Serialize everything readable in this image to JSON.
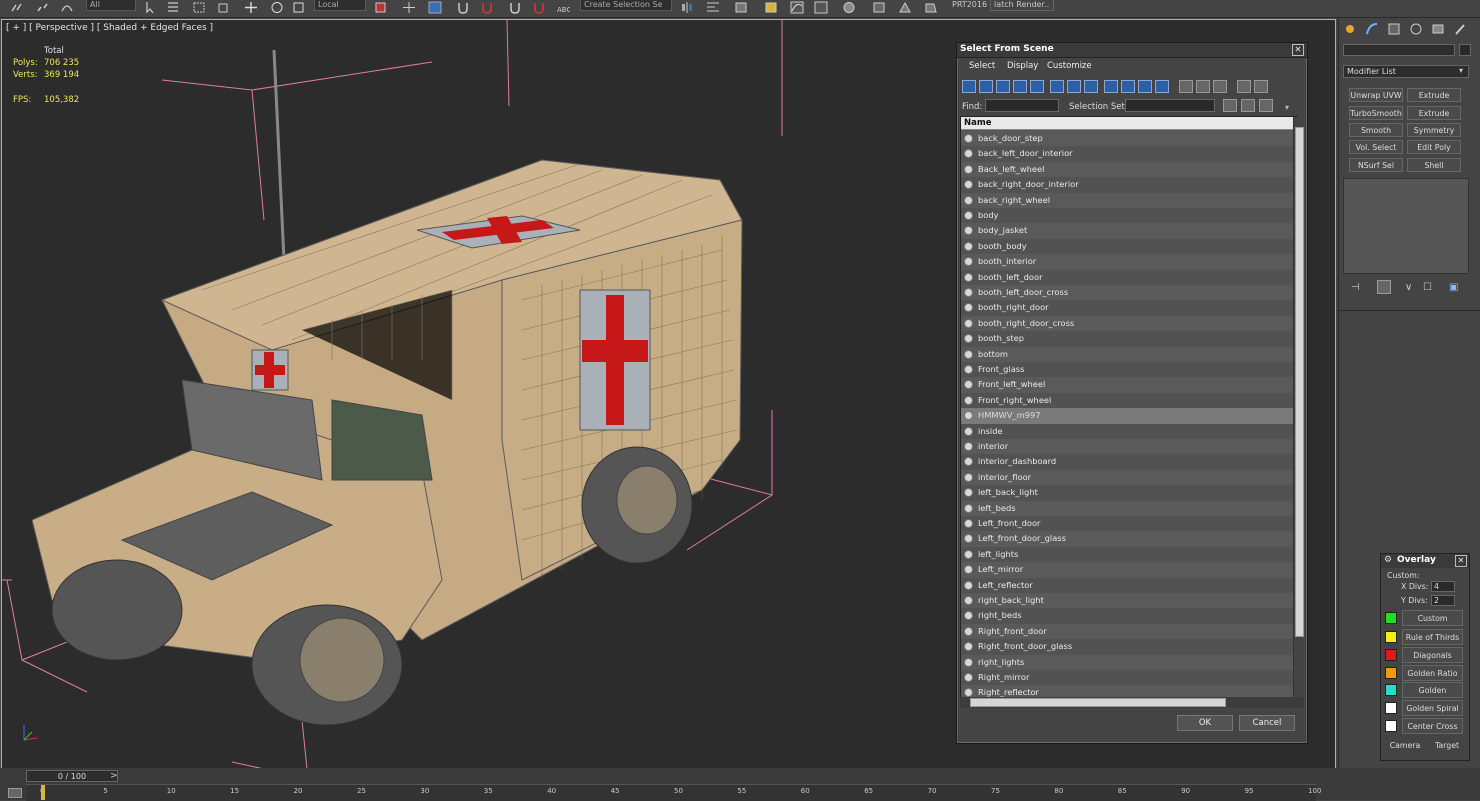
{
  "toolbar": {
    "coord_system": "Local",
    "named_selection": "Create Selection Se",
    "prt_label": "PRT2016",
    "batch_label": "latch Render..",
    "icons": [
      "link-icon",
      "unlink-icon",
      "bind-icon",
      "select-icon",
      "region-select-icon",
      "window-icon",
      "move-icon",
      "rotate-icon",
      "scale-icon",
      "pivot-icon",
      "snap-icon",
      "angle-snap-icon",
      "percent-snap-icon",
      "spinner-snap-icon",
      "edit-named-icon",
      "mirror-icon",
      "align-icon",
      "layer-icon",
      "scene-explorer-icon",
      "curve-editor-icon",
      "schematic-icon",
      "material-editor-icon",
      "render-setup-icon",
      "render-frame-icon",
      "render-icon"
    ]
  },
  "viewport": {
    "label": "[ + ] [ Perspective ] [ Shaded + Edged Faces ]",
    "stats": {
      "total_label": "Total",
      "polys_label": "Polys:",
      "polys_value": "706 235",
      "verts_label": "Verts:",
      "verts_value": "369 194",
      "fps_label": "FPS:",
      "fps_value": "105,382"
    },
    "colors": {
      "border": "#d4b545",
      "background": "#2c2c2c",
      "bbox": "#e07aa8"
    }
  },
  "dialog": {
    "title": "Select From Scene",
    "menu": [
      "Select",
      "Display",
      "Customize"
    ],
    "find_label": "Find:",
    "find_value": "",
    "selection_set_label": "Selection Set:",
    "list_header": "Name",
    "items": [
      "back_door_step",
      "back_left_door_interior",
      "Back_left_wheel",
      "back_right_door_interior",
      "back_right_wheel",
      "body",
      "body_jasket",
      "booth_body",
      "booth_interior",
      "booth_left_door",
      "booth_left_door_cross",
      "booth_right_door",
      "booth_right_door_cross",
      "booth_step",
      "bottom",
      "Front_glass",
      "Front_left_wheel",
      "Front_right_wheel",
      "HMMWV_m997",
      "inside",
      "interior",
      "interior_dashboard",
      "interior_floor",
      "left_back_light",
      "left_beds",
      "Left_front_door",
      "Left_front_door_glass",
      "left_lights",
      "Left_mirror",
      "Left_reflector",
      "right_back_light",
      "right_beds",
      "Right_front_door",
      "Right_front_door_glass",
      "right_lights",
      "Right_mirror",
      "Right_reflector"
    ],
    "selected_item": "HMMWV_m997",
    "ok_label": "OK",
    "cancel_label": "Cancel"
  },
  "right_panel": {
    "modifier_list": "Modifier List",
    "modifiers": [
      [
        "Unwrap UVW",
        "Extrude"
      ],
      [
        "TurboSmooth",
        "Extrude"
      ],
      [
        "Smooth",
        "Symmetry"
      ],
      [
        "Vol. Select",
        "Edit Poly"
      ],
      [
        "NSurf Sel",
        "Shell"
      ]
    ]
  },
  "overlay": {
    "title": "Overlay",
    "custom_label": "Custom:",
    "xdivs_label": "X Divs:",
    "xdivs_value": "4",
    "ydivs_label": "Y Divs:",
    "ydivs_value": "2",
    "items": [
      {
        "label": "Custom",
        "color": "#22dd22"
      },
      {
        "label": "Rule of Thirds",
        "color": "#f2f20a"
      },
      {
        "label": "Diagonals",
        "color": "#e01818"
      },
      {
        "label": "Golden Ratio",
        "color": "#f09a10"
      },
      {
        "label": "Golden Triangle",
        "color": "#20e0c8"
      },
      {
        "label": "Golden Spiral",
        "color": "#ffffff"
      },
      {
        "label": "Center Cross",
        "color": "#ffffff"
      }
    ],
    "camera_label": "Camera",
    "target_label": "Target"
  },
  "timeline": {
    "slider": "0 / 100",
    "ticks": [
      "0",
      "5",
      "10",
      "15",
      "20",
      "25",
      "30",
      "35",
      "40",
      "45",
      "50",
      "55",
      "60",
      "65",
      "70",
      "75",
      "80",
      "85",
      "90",
      "95",
      "100"
    ]
  }
}
